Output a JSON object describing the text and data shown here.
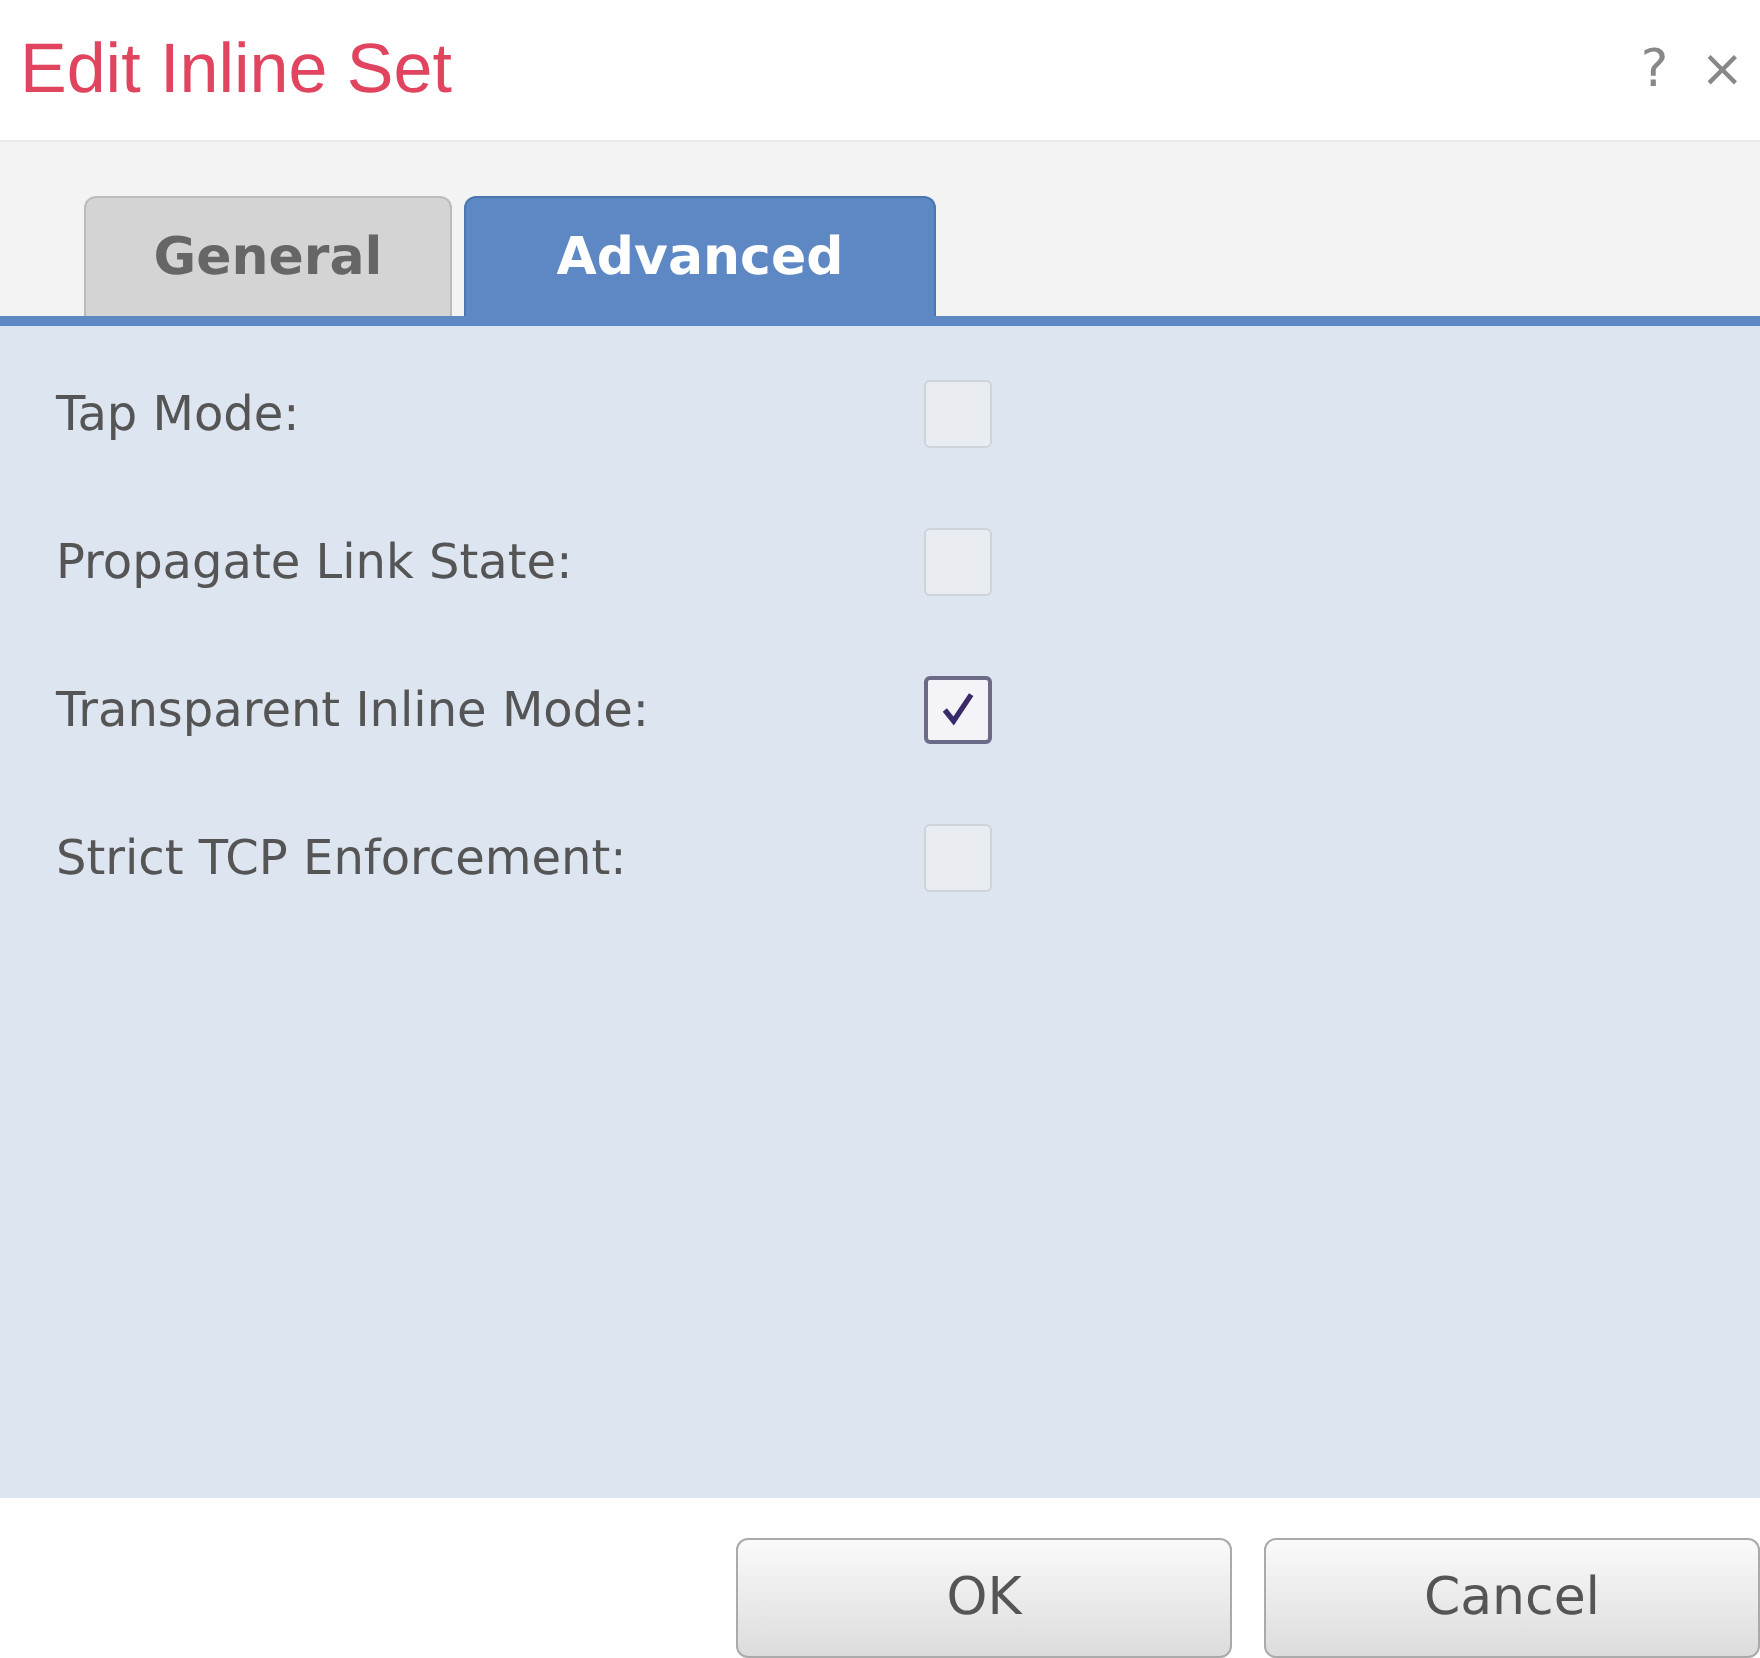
{
  "window": {
    "title": "Edit Inline Set",
    "help": "?",
    "close": "×"
  },
  "tabs": [
    {
      "label": "General",
      "selected": false
    },
    {
      "label": "Advanced",
      "selected": true
    }
  ],
  "options": [
    {
      "label": "Tap Mode:",
      "checked": false
    },
    {
      "label": "Propagate Link State:",
      "checked": false
    },
    {
      "label": "Transparent Inline Mode:",
      "checked": true
    },
    {
      "label": "Strict TCP Enforcement:",
      "checked": false
    }
  ],
  "buttons": [
    "OK",
    "Cancel"
  ]
}
